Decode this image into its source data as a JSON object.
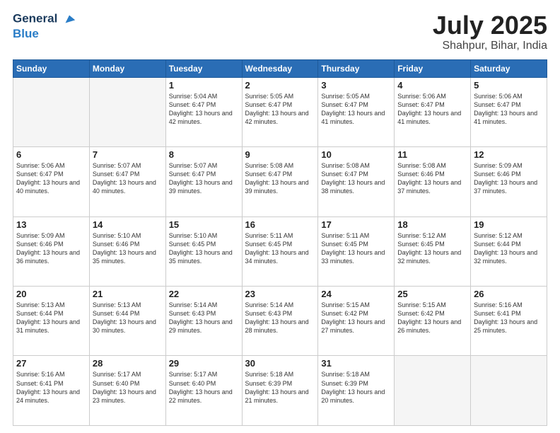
{
  "header": {
    "logo_line1": "General",
    "logo_line2": "Blue",
    "month": "July 2025",
    "location": "Shahpur, Bihar, India"
  },
  "weekdays": [
    "Sunday",
    "Monday",
    "Tuesday",
    "Wednesday",
    "Thursday",
    "Friday",
    "Saturday"
  ],
  "weeks": [
    [
      {
        "day": "",
        "info": ""
      },
      {
        "day": "",
        "info": ""
      },
      {
        "day": "1",
        "info": "Sunrise: 5:04 AM\nSunset: 6:47 PM\nDaylight: 13 hours and 42 minutes."
      },
      {
        "day": "2",
        "info": "Sunrise: 5:05 AM\nSunset: 6:47 PM\nDaylight: 13 hours and 42 minutes."
      },
      {
        "day": "3",
        "info": "Sunrise: 5:05 AM\nSunset: 6:47 PM\nDaylight: 13 hours and 41 minutes."
      },
      {
        "day": "4",
        "info": "Sunrise: 5:06 AM\nSunset: 6:47 PM\nDaylight: 13 hours and 41 minutes."
      },
      {
        "day": "5",
        "info": "Sunrise: 5:06 AM\nSunset: 6:47 PM\nDaylight: 13 hours and 41 minutes."
      }
    ],
    [
      {
        "day": "6",
        "info": "Sunrise: 5:06 AM\nSunset: 6:47 PM\nDaylight: 13 hours and 40 minutes."
      },
      {
        "day": "7",
        "info": "Sunrise: 5:07 AM\nSunset: 6:47 PM\nDaylight: 13 hours and 40 minutes."
      },
      {
        "day": "8",
        "info": "Sunrise: 5:07 AM\nSunset: 6:47 PM\nDaylight: 13 hours and 39 minutes."
      },
      {
        "day": "9",
        "info": "Sunrise: 5:08 AM\nSunset: 6:47 PM\nDaylight: 13 hours and 39 minutes."
      },
      {
        "day": "10",
        "info": "Sunrise: 5:08 AM\nSunset: 6:47 PM\nDaylight: 13 hours and 38 minutes."
      },
      {
        "day": "11",
        "info": "Sunrise: 5:08 AM\nSunset: 6:46 PM\nDaylight: 13 hours and 37 minutes."
      },
      {
        "day": "12",
        "info": "Sunrise: 5:09 AM\nSunset: 6:46 PM\nDaylight: 13 hours and 37 minutes."
      }
    ],
    [
      {
        "day": "13",
        "info": "Sunrise: 5:09 AM\nSunset: 6:46 PM\nDaylight: 13 hours and 36 minutes."
      },
      {
        "day": "14",
        "info": "Sunrise: 5:10 AM\nSunset: 6:46 PM\nDaylight: 13 hours and 35 minutes."
      },
      {
        "day": "15",
        "info": "Sunrise: 5:10 AM\nSunset: 6:45 PM\nDaylight: 13 hours and 35 minutes."
      },
      {
        "day": "16",
        "info": "Sunrise: 5:11 AM\nSunset: 6:45 PM\nDaylight: 13 hours and 34 minutes."
      },
      {
        "day": "17",
        "info": "Sunrise: 5:11 AM\nSunset: 6:45 PM\nDaylight: 13 hours and 33 minutes."
      },
      {
        "day": "18",
        "info": "Sunrise: 5:12 AM\nSunset: 6:45 PM\nDaylight: 13 hours and 32 minutes."
      },
      {
        "day": "19",
        "info": "Sunrise: 5:12 AM\nSunset: 6:44 PM\nDaylight: 13 hours and 32 minutes."
      }
    ],
    [
      {
        "day": "20",
        "info": "Sunrise: 5:13 AM\nSunset: 6:44 PM\nDaylight: 13 hours and 31 minutes."
      },
      {
        "day": "21",
        "info": "Sunrise: 5:13 AM\nSunset: 6:44 PM\nDaylight: 13 hours and 30 minutes."
      },
      {
        "day": "22",
        "info": "Sunrise: 5:14 AM\nSunset: 6:43 PM\nDaylight: 13 hours and 29 minutes."
      },
      {
        "day": "23",
        "info": "Sunrise: 5:14 AM\nSunset: 6:43 PM\nDaylight: 13 hours and 28 minutes."
      },
      {
        "day": "24",
        "info": "Sunrise: 5:15 AM\nSunset: 6:42 PM\nDaylight: 13 hours and 27 minutes."
      },
      {
        "day": "25",
        "info": "Sunrise: 5:15 AM\nSunset: 6:42 PM\nDaylight: 13 hours and 26 minutes."
      },
      {
        "day": "26",
        "info": "Sunrise: 5:16 AM\nSunset: 6:41 PM\nDaylight: 13 hours and 25 minutes."
      }
    ],
    [
      {
        "day": "27",
        "info": "Sunrise: 5:16 AM\nSunset: 6:41 PM\nDaylight: 13 hours and 24 minutes."
      },
      {
        "day": "28",
        "info": "Sunrise: 5:17 AM\nSunset: 6:40 PM\nDaylight: 13 hours and 23 minutes."
      },
      {
        "day": "29",
        "info": "Sunrise: 5:17 AM\nSunset: 6:40 PM\nDaylight: 13 hours and 22 minutes."
      },
      {
        "day": "30",
        "info": "Sunrise: 5:18 AM\nSunset: 6:39 PM\nDaylight: 13 hours and 21 minutes."
      },
      {
        "day": "31",
        "info": "Sunrise: 5:18 AM\nSunset: 6:39 PM\nDaylight: 13 hours and 20 minutes."
      },
      {
        "day": "",
        "info": ""
      },
      {
        "day": "",
        "info": ""
      }
    ]
  ]
}
